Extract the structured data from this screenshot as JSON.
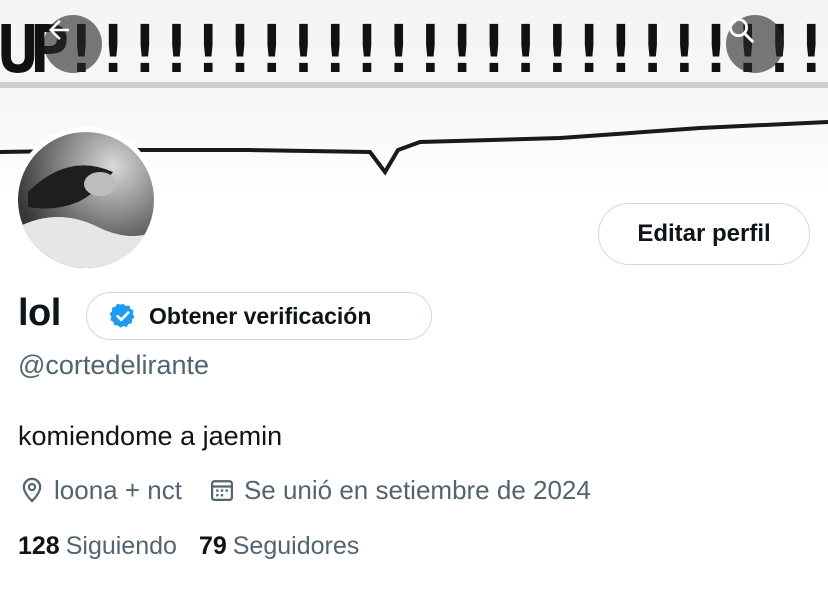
{
  "banner": {
    "image_text": "UP!!!!!!!!!!!!!!!!!!!!!!!!!!!!!!!!!!!!"
  },
  "nav": {
    "back_icon": "arrow-left-icon",
    "search_icon": "search-icon"
  },
  "profile": {
    "name": "lol",
    "verify_label": "Obtener verificación",
    "verified_badge_color": "#1d9bf0",
    "edit_label": "Editar perfil",
    "handle": "@cortedelirante",
    "bio": "komiendome a jaemin",
    "location": "loona + nct",
    "joined": "Se unió en setiembre de 2024"
  },
  "stats": {
    "following_count": "128",
    "following_label": "Siguiendo",
    "followers_count": "79",
    "followers_label": "Seguidores"
  },
  "colors": {
    "text_primary": "#0f1419",
    "text_secondary": "#536471",
    "border": "#cfd9de"
  }
}
